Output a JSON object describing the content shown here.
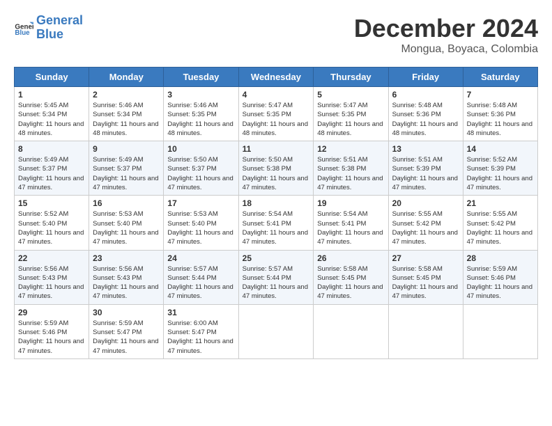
{
  "header": {
    "logo_line1": "General",
    "logo_line2": "Blue",
    "month": "December 2024",
    "location": "Mongua, Boyaca, Colombia"
  },
  "days_of_week": [
    "Sunday",
    "Monday",
    "Tuesday",
    "Wednesday",
    "Thursday",
    "Friday",
    "Saturday"
  ],
  "weeks": [
    [
      {
        "day": "1",
        "sunrise": "5:45 AM",
        "sunset": "5:34 PM",
        "daylight": "11 hours and 48 minutes."
      },
      {
        "day": "2",
        "sunrise": "5:46 AM",
        "sunset": "5:34 PM",
        "daylight": "11 hours and 48 minutes."
      },
      {
        "day": "3",
        "sunrise": "5:46 AM",
        "sunset": "5:35 PM",
        "daylight": "11 hours and 48 minutes."
      },
      {
        "day": "4",
        "sunrise": "5:47 AM",
        "sunset": "5:35 PM",
        "daylight": "11 hours and 48 minutes."
      },
      {
        "day": "5",
        "sunrise": "5:47 AM",
        "sunset": "5:35 PM",
        "daylight": "11 hours and 48 minutes."
      },
      {
        "day": "6",
        "sunrise": "5:48 AM",
        "sunset": "5:36 PM",
        "daylight": "11 hours and 48 minutes."
      },
      {
        "day": "7",
        "sunrise": "5:48 AM",
        "sunset": "5:36 PM",
        "daylight": "11 hours and 48 minutes."
      }
    ],
    [
      {
        "day": "8",
        "sunrise": "5:49 AM",
        "sunset": "5:37 PM",
        "daylight": "11 hours and 47 minutes."
      },
      {
        "day": "9",
        "sunrise": "5:49 AM",
        "sunset": "5:37 PM",
        "daylight": "11 hours and 47 minutes."
      },
      {
        "day": "10",
        "sunrise": "5:50 AM",
        "sunset": "5:37 PM",
        "daylight": "11 hours and 47 minutes."
      },
      {
        "day": "11",
        "sunrise": "5:50 AM",
        "sunset": "5:38 PM",
        "daylight": "11 hours and 47 minutes."
      },
      {
        "day": "12",
        "sunrise": "5:51 AM",
        "sunset": "5:38 PM",
        "daylight": "11 hours and 47 minutes."
      },
      {
        "day": "13",
        "sunrise": "5:51 AM",
        "sunset": "5:39 PM",
        "daylight": "11 hours and 47 minutes."
      },
      {
        "day": "14",
        "sunrise": "5:52 AM",
        "sunset": "5:39 PM",
        "daylight": "11 hours and 47 minutes."
      }
    ],
    [
      {
        "day": "15",
        "sunrise": "5:52 AM",
        "sunset": "5:40 PM",
        "daylight": "11 hours and 47 minutes."
      },
      {
        "day": "16",
        "sunrise": "5:53 AM",
        "sunset": "5:40 PM",
        "daylight": "11 hours and 47 minutes."
      },
      {
        "day": "17",
        "sunrise": "5:53 AM",
        "sunset": "5:40 PM",
        "daylight": "11 hours and 47 minutes."
      },
      {
        "day": "18",
        "sunrise": "5:54 AM",
        "sunset": "5:41 PM",
        "daylight": "11 hours and 47 minutes."
      },
      {
        "day": "19",
        "sunrise": "5:54 AM",
        "sunset": "5:41 PM",
        "daylight": "11 hours and 47 minutes."
      },
      {
        "day": "20",
        "sunrise": "5:55 AM",
        "sunset": "5:42 PM",
        "daylight": "11 hours and 47 minutes."
      },
      {
        "day": "21",
        "sunrise": "5:55 AM",
        "sunset": "5:42 PM",
        "daylight": "11 hours and 47 minutes."
      }
    ],
    [
      {
        "day": "22",
        "sunrise": "5:56 AM",
        "sunset": "5:43 PM",
        "daylight": "11 hours and 47 minutes."
      },
      {
        "day": "23",
        "sunrise": "5:56 AM",
        "sunset": "5:43 PM",
        "daylight": "11 hours and 47 minutes."
      },
      {
        "day": "24",
        "sunrise": "5:57 AM",
        "sunset": "5:44 PM",
        "daylight": "11 hours and 47 minutes."
      },
      {
        "day": "25",
        "sunrise": "5:57 AM",
        "sunset": "5:44 PM",
        "daylight": "11 hours and 47 minutes."
      },
      {
        "day": "26",
        "sunrise": "5:58 AM",
        "sunset": "5:45 PM",
        "daylight": "11 hours and 47 minutes."
      },
      {
        "day": "27",
        "sunrise": "5:58 AM",
        "sunset": "5:45 PM",
        "daylight": "11 hours and 47 minutes."
      },
      {
        "day": "28",
        "sunrise": "5:59 AM",
        "sunset": "5:46 PM",
        "daylight": "11 hours and 47 minutes."
      }
    ],
    [
      {
        "day": "29",
        "sunrise": "5:59 AM",
        "sunset": "5:46 PM",
        "daylight": "11 hours and 47 minutes."
      },
      {
        "day": "30",
        "sunrise": "5:59 AM",
        "sunset": "5:47 PM",
        "daylight": "11 hours and 47 minutes."
      },
      {
        "day": "31",
        "sunrise": "6:00 AM",
        "sunset": "5:47 PM",
        "daylight": "11 hours and 47 minutes."
      },
      null,
      null,
      null,
      null
    ]
  ]
}
